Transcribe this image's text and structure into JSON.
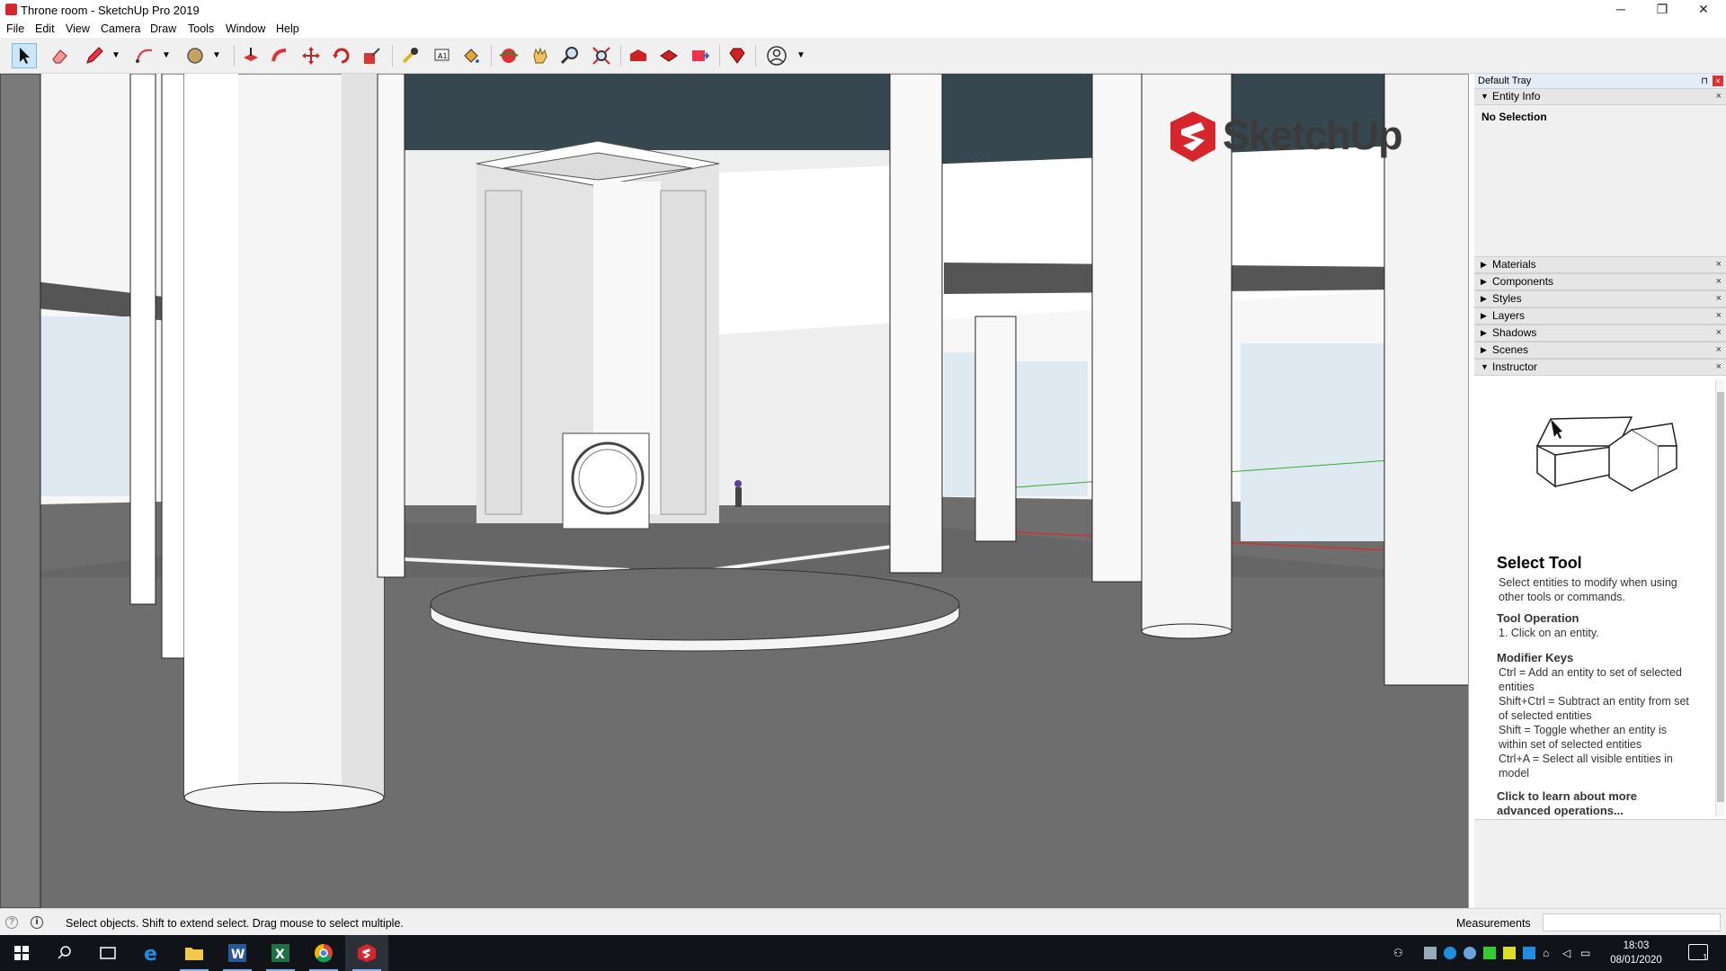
{
  "window": {
    "title": "Throne room - SketchUp Pro 2019",
    "minimize": "─",
    "maximize": "❐",
    "close": "✕"
  },
  "menu": [
    "File",
    "Edit",
    "View",
    "Camera",
    "Draw",
    "Tools",
    "Window",
    "Help"
  ],
  "toolbar": {
    "tools": [
      "select-icon",
      "eraser-icon",
      "pencil-icon",
      "arc-icon",
      "circle-icon",
      "push-pull-icon",
      "follow-me-icon",
      "move-icon",
      "rotate-icon",
      "scale-icon",
      "tape-measure-icon",
      "text-icon",
      "paint-bucket-icon",
      "orbit-icon",
      "pan-icon",
      "zoom-icon",
      "zoom-extents-icon",
      "warehouse-icon",
      "extension-warehouse-icon",
      "send-to-layout-icon",
      "ruby-icon",
      "account-icon"
    ]
  },
  "viewport": {
    "logo_text": "SketchUp"
  },
  "tray": {
    "title": "Default Tray",
    "pin": "⊓",
    "close": "×",
    "entity_info": {
      "label": "Entity Info",
      "selection": "No Selection"
    },
    "panels": [
      "Materials",
      "Components",
      "Styles",
      "Layers",
      "Shadows",
      "Scenes"
    ],
    "instructor": {
      "label": "Instructor",
      "tool_title": "Select Tool",
      "tool_desc": "Select entities to modify when using other tools or commands.",
      "operation_heading": "Tool Operation",
      "operation_text": "1. Click on an entity.",
      "modifier_heading": "Modifier Keys",
      "modifier_lines": [
        "Ctrl = Add an entity to set of selected entities",
        "Shift+Ctrl = Subtract an entity from set of selected entities",
        "Shift = Toggle whether an entity is within set of selected entities",
        "Ctrl+A = Select all visible entities in model"
      ],
      "more_link": "Click to learn about more advanced operations..."
    }
  },
  "status": {
    "message": "Select objects. Shift to extend select. Drag mouse to select multiple.",
    "measurements_label": "Measurements",
    "measurements_value": ""
  },
  "taskbar": {
    "apps": [
      "windows-start-icon",
      "search-icon",
      "task-view-icon",
      "edge-icon",
      "file-explorer-icon",
      "word-icon",
      "excel-icon",
      "chrome-icon",
      "sketchup-icon"
    ],
    "time": "18:03",
    "date": "08/01/2020",
    "notification_count": "1"
  },
  "colors": {
    "accent": "#d6262b",
    "sky": "#dfe9f1",
    "ceiling": "#37474f",
    "floor": "#6e6e6e"
  }
}
